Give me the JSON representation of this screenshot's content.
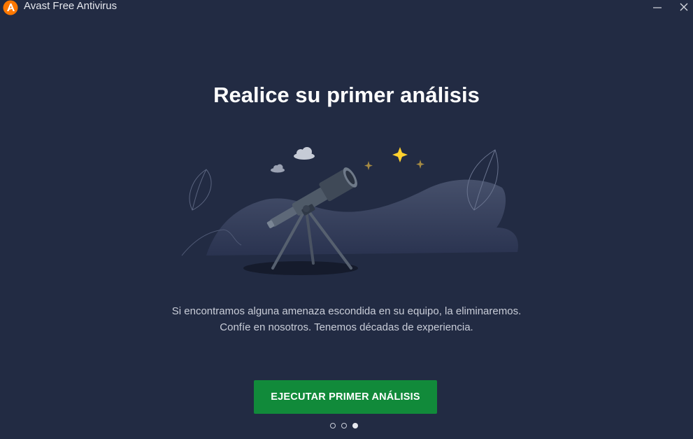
{
  "window": {
    "title": "Avast Free Antivirus",
    "controls": [
      "minimize",
      "close"
    ]
  },
  "main": {
    "heading": "Realice su primer análisis",
    "description_line1": "Si encontramos alguna amenaza escondida en su equipo, la eliminaremos.",
    "description_line2": "Confíe en nosotros. Tenemos décadas de experiencia.",
    "cta_label": "EJECUTAR PRIMER ANÁLISIS"
  },
  "pager": {
    "total": 3,
    "active_index": 2
  },
  "colors": {
    "background": "#222b43",
    "cta": "#118a3a",
    "brand": "#ff7800",
    "star": "#ffd12e"
  },
  "icons": {
    "logo": "avast-logo-icon",
    "minimize": "minimize-icon",
    "close": "close-icon",
    "illustration": "telescope-illustration"
  }
}
